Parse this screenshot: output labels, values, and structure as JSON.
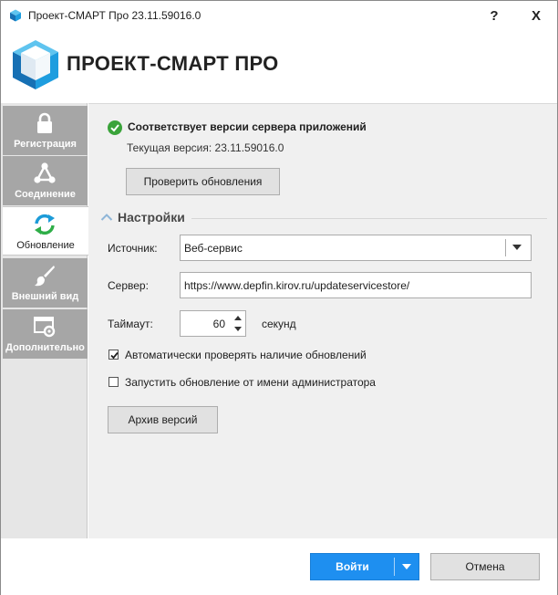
{
  "window": {
    "title": "Проект-СМАРТ Про 23.11.59016.0",
    "help_label": "?",
    "close_label": "X"
  },
  "header": {
    "brand": "ПРОЕКТ-СМАРТ ПРО",
    "colors": {
      "logo_light": "#5fc4ef",
      "logo_mid": "#1e9ddf",
      "logo_dark": "#1670b4"
    }
  },
  "sidebar": {
    "items": [
      {
        "label": "Регистрация",
        "icon": "lock-icon",
        "active": false
      },
      {
        "label": "Соединение",
        "icon": "network-icon",
        "active": false
      },
      {
        "label": "Обновление",
        "icon": "refresh-icon",
        "active": true
      },
      {
        "label": "Внешний вид",
        "icon": "brush-icon",
        "active": false
      },
      {
        "label": "Дополнительно",
        "icon": "window-gear-icon",
        "active": false
      }
    ]
  },
  "update": {
    "status": "Соответствует версии сервера приложений",
    "current_version": "Текущая версия: 23.11.59016.0",
    "check_button": "Проверить обновления",
    "status_color": "#3aa33a"
  },
  "settings": {
    "title": "Настройки",
    "source_label": "Источник:",
    "source_value": "Веб-сервис",
    "server_label": "Сервер:",
    "server_value": "https://www.depfin.kirov.ru/updateservicestore/",
    "timeout_label": "Таймаут:",
    "timeout_value": "60",
    "timeout_unit": "секунд",
    "auto_check_label": "Автоматически проверять наличие обновлений",
    "auto_check_checked": true,
    "run_as_admin_label": "Запустить обновление от имени администратора",
    "run_as_admin_checked": false,
    "archive_button": "Архив версий"
  },
  "footer": {
    "ok_button": "Войти",
    "cancel_button": "Отмена",
    "ok_color": "#1e8ff0"
  }
}
